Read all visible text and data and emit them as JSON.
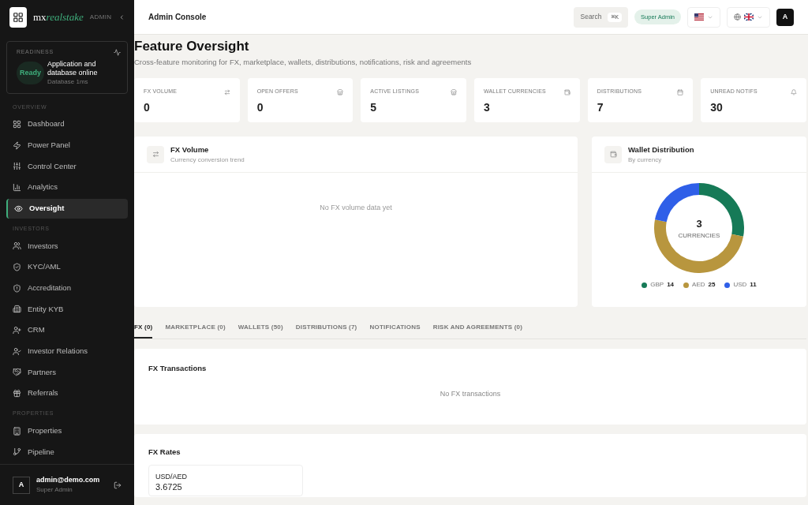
{
  "brand": {
    "name_prefix": "mx",
    "name_suffix": "realstake",
    "tag": "ADMIN"
  },
  "readiness": {
    "label": "READINESS",
    "status": "Ready",
    "title": "Application and database online",
    "detail": "Database 1ms"
  },
  "sidebar": {
    "sections": [
      {
        "title": "OVERVIEW",
        "items": [
          {
            "label": "Dashboard",
            "selected": false
          },
          {
            "label": "Power Panel",
            "selected": false
          },
          {
            "label": "Control Center",
            "selected": false
          },
          {
            "label": "Analytics",
            "selected": false
          },
          {
            "label": "Oversight",
            "selected": true
          }
        ]
      },
      {
        "title": "INVESTORS",
        "items": [
          {
            "label": "Investors",
            "selected": false
          },
          {
            "label": "KYC/AML",
            "selected": false
          },
          {
            "label": "Accreditation",
            "selected": false
          },
          {
            "label": "Entity KYB",
            "selected": false
          },
          {
            "label": "CRM",
            "selected": false
          },
          {
            "label": "Investor Relations",
            "selected": false
          },
          {
            "label": "Partners",
            "selected": false
          },
          {
            "label": "Referrals",
            "selected": false
          }
        ]
      },
      {
        "title": "PROPERTIES",
        "items": [
          {
            "label": "Properties",
            "selected": false
          },
          {
            "label": "Pipeline",
            "selected": false
          }
        ]
      }
    ]
  },
  "user": {
    "avatar": "A",
    "email": "admin@demo.com",
    "role": "Super Admin"
  },
  "header": {
    "title": "Admin Console",
    "search": "Search",
    "shortcut": "⌘K",
    "role_badge": "Super Admin",
    "avatar": "A"
  },
  "page": {
    "title": "Feature Oversight",
    "subtitle": "Cross-feature monitoring for FX, marketplace, wallets, distributions, notifications, risk and agreements"
  },
  "stats": [
    {
      "label": "FX VOLUME",
      "value": "0"
    },
    {
      "label": "OPEN OFFERS",
      "value": "0"
    },
    {
      "label": "ACTIVE LISTINGS",
      "value": "5"
    },
    {
      "label": "WALLET CURRENCIES",
      "value": "3"
    },
    {
      "label": "DISTRIBUTIONS",
      "value": "7"
    },
    {
      "label": "UNREAD NOTIFS",
      "value": "30"
    }
  ],
  "fx_volume": {
    "title": "FX Volume",
    "subtitle": "Currency conversion trend",
    "empty": "No FX volume data yet"
  },
  "wallet_distribution": {
    "title": "Wallet Distribution",
    "subtitle": "By currency",
    "center_value": "3",
    "center_label": "CURRENCIES",
    "legend": [
      {
        "label": "GBP",
        "count": "14",
        "color": "#167a57"
      },
      {
        "label": "AED",
        "count": "25",
        "color": "#b8963e"
      },
      {
        "label": "USD",
        "count": "11",
        "color": "#2f5fe8"
      }
    ],
    "chart_data": {
      "type": "donut",
      "values": [
        28,
        50,
        22
      ]
    }
  },
  "tabs": [
    {
      "label": "FX (0)",
      "selected": true
    },
    {
      "label": "MARKETPLACE (0)",
      "selected": false
    },
    {
      "label": "WALLETS (50)",
      "selected": false
    },
    {
      "label": "DISTRIBUTIONS (7)",
      "selected": false
    },
    {
      "label": "NOTIFICATIONS",
      "selected": false
    },
    {
      "label": "RISK AND AGREEMENTS (0)",
      "selected": false
    }
  ],
  "fx_transactions": {
    "title": "FX Transactions",
    "empty": "No FX transactions"
  },
  "fx_rates": {
    "title": "FX Rates",
    "rates": [
      {
        "pair": "USD/AED",
        "value": "3.6725"
      }
    ]
  }
}
